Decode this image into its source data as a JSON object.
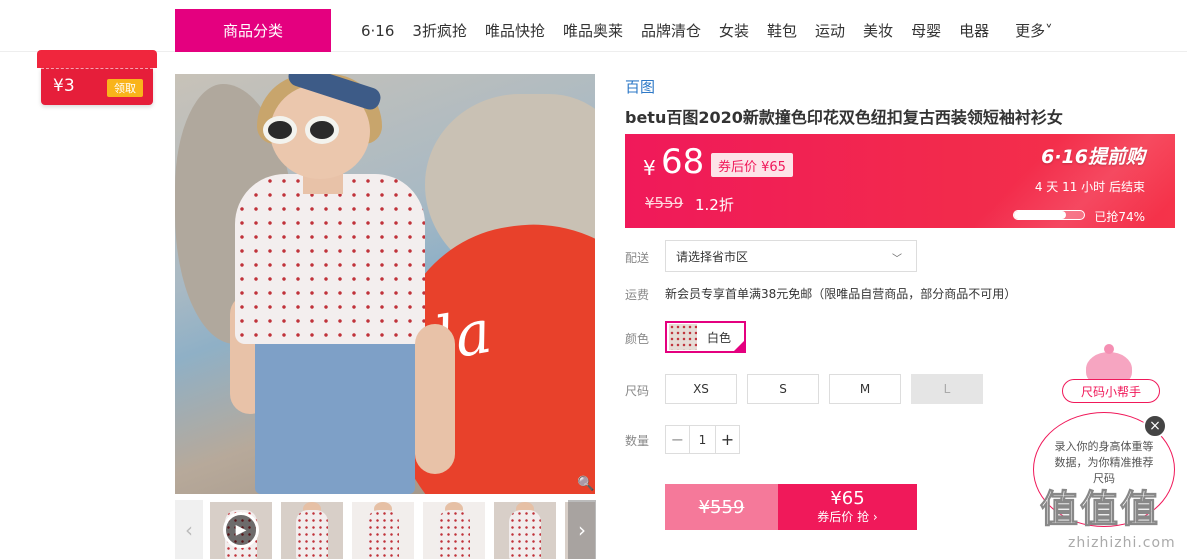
{
  "nav": {
    "category_btn": "商品分类",
    "items": [
      "6·16",
      "3折疯抢",
      "唯品快抢",
      "唯品奥莱",
      "品牌清仓",
      "女装",
      "鞋包",
      "运动",
      "美妆",
      "母婴",
      "电器"
    ],
    "more": "更多˅"
  },
  "coupon": {
    "amount": "¥3",
    "claim": "领取"
  },
  "gallery": {
    "board_text": "ola",
    "zoom_icon": "zoom-icon",
    "thumbs_count_visible": 6
  },
  "product": {
    "brand": "百图",
    "title": "betu百图2020新款撞色印花双色纽扣复古西装领短袖衬衫女"
  },
  "price": {
    "currency": "¥",
    "value": "68",
    "after_coupon": "券后价 ¥65",
    "original": "¥559",
    "discount": "1.2折",
    "promo_title": "6·16提前购",
    "countdown": "4 天 11 小时 后结束",
    "sold_ratio": 0.74,
    "sold_text": "已抢74%"
  },
  "options": {
    "delivery_label": "配送",
    "delivery_value": "请选择省市区",
    "shipping_label": "运费",
    "shipping_text": "新会员专享首单满38元免邮（限唯品自营商品，部分商品不可用）",
    "color_label": "颜色",
    "color_value": "白色",
    "size_label": "尺码",
    "sizes": [
      "XS",
      "S",
      "M",
      "L"
    ],
    "qty_label": "数量",
    "qty_minus": "−",
    "qty_value": "1",
    "qty_plus": "+"
  },
  "buy": {
    "original": "¥559",
    "price": "¥65",
    "sub": "券后价 抢 ›"
  },
  "helper": {
    "title": "尺码小帮手",
    "text": "录入你的身高体重等数据，为你精准推荐尺码",
    "close": "×"
  },
  "watermark": {
    "text": "值值值",
    "url": "zhizhizhi.com"
  },
  "colors": {
    "accent": "#e4007f",
    "price_red": "#f0195a",
    "link_blue": "#2e79c7"
  }
}
